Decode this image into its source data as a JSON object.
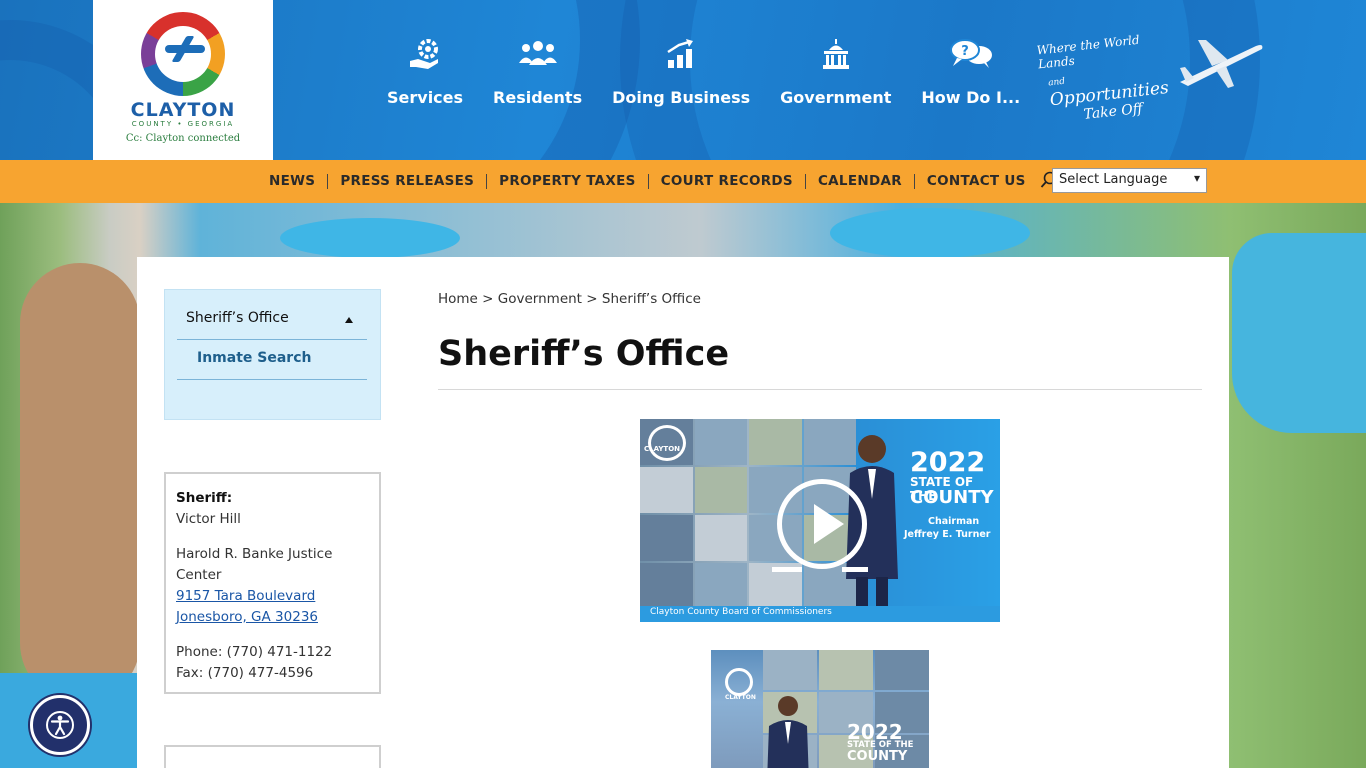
{
  "logo": {
    "name": "CLAYTON",
    "subtitle": "COUNTY • GEORGIA",
    "tagline": "Cc: Clayton connected"
  },
  "main_nav": {
    "items": [
      {
        "label": "Services",
        "icon": "gear-hand-icon"
      },
      {
        "label": "Residents",
        "icon": "people-icon"
      },
      {
        "label": "Doing Business",
        "icon": "growth-chart-icon"
      },
      {
        "label": "Government",
        "icon": "capitol-building-icon"
      },
      {
        "label": "How Do I...",
        "icon": "question-chat-icon"
      }
    ]
  },
  "slogan": {
    "line1": "Where the World Lands",
    "line2": "Opportunities",
    "line2_prefix": "and",
    "line3": "Take Off"
  },
  "utility_nav": {
    "items": [
      "NEWS",
      "PRESS RELEASES",
      "PROPERTY TAXES",
      "COURT RECORDS",
      "CALENDAR",
      "CONTACT US"
    ],
    "search_icon": "search-icon"
  },
  "language_select": {
    "selected": "Select Language"
  },
  "sidebar": {
    "section_title": "Sheriff’s Office",
    "links": [
      "Inmate Search"
    ]
  },
  "contact": {
    "sheriff_label": "Sheriff:",
    "sheriff_name": "Victor Hill",
    "building_line1": "Harold R. Banke Justice",
    "building_line2": "Center",
    "address_line1": "9157 Tara Boulevard",
    "address_line2": "Jonesboro, GA 30236",
    "phone": "Phone: (770) 471-1122",
    "fax": "Fax: (770) 477-4596"
  },
  "breadcrumb": {
    "items": [
      "Home",
      "Government",
      "Sheriff’s Office"
    ],
    "separator": ">"
  },
  "page": {
    "title": "Sheriff’s Office"
  },
  "video_primary": {
    "year": "2022",
    "subtitle_small": "STATE OF THE",
    "subtitle_large": "COUNTY",
    "chair_title": "Chairman",
    "chair_name": "Jeffrey E. Turner",
    "footer": "Clayton County Board of Commissioners",
    "logo_text": "CLAYTON"
  },
  "video_secondary": {
    "year": "2022",
    "subtitle_small": "STATE OF THE",
    "subtitle_large": "COUNTY",
    "logo_text": "CLAYTON"
  },
  "accessibility": {
    "icon": "accessibility-icon"
  },
  "colors": {
    "header_blue": "#1f86d6",
    "util_orange": "#f7a430",
    "sidebar_bg": "#d7effb",
    "link_blue": "#1e5f8c",
    "a11y_navy": "#22306b"
  }
}
